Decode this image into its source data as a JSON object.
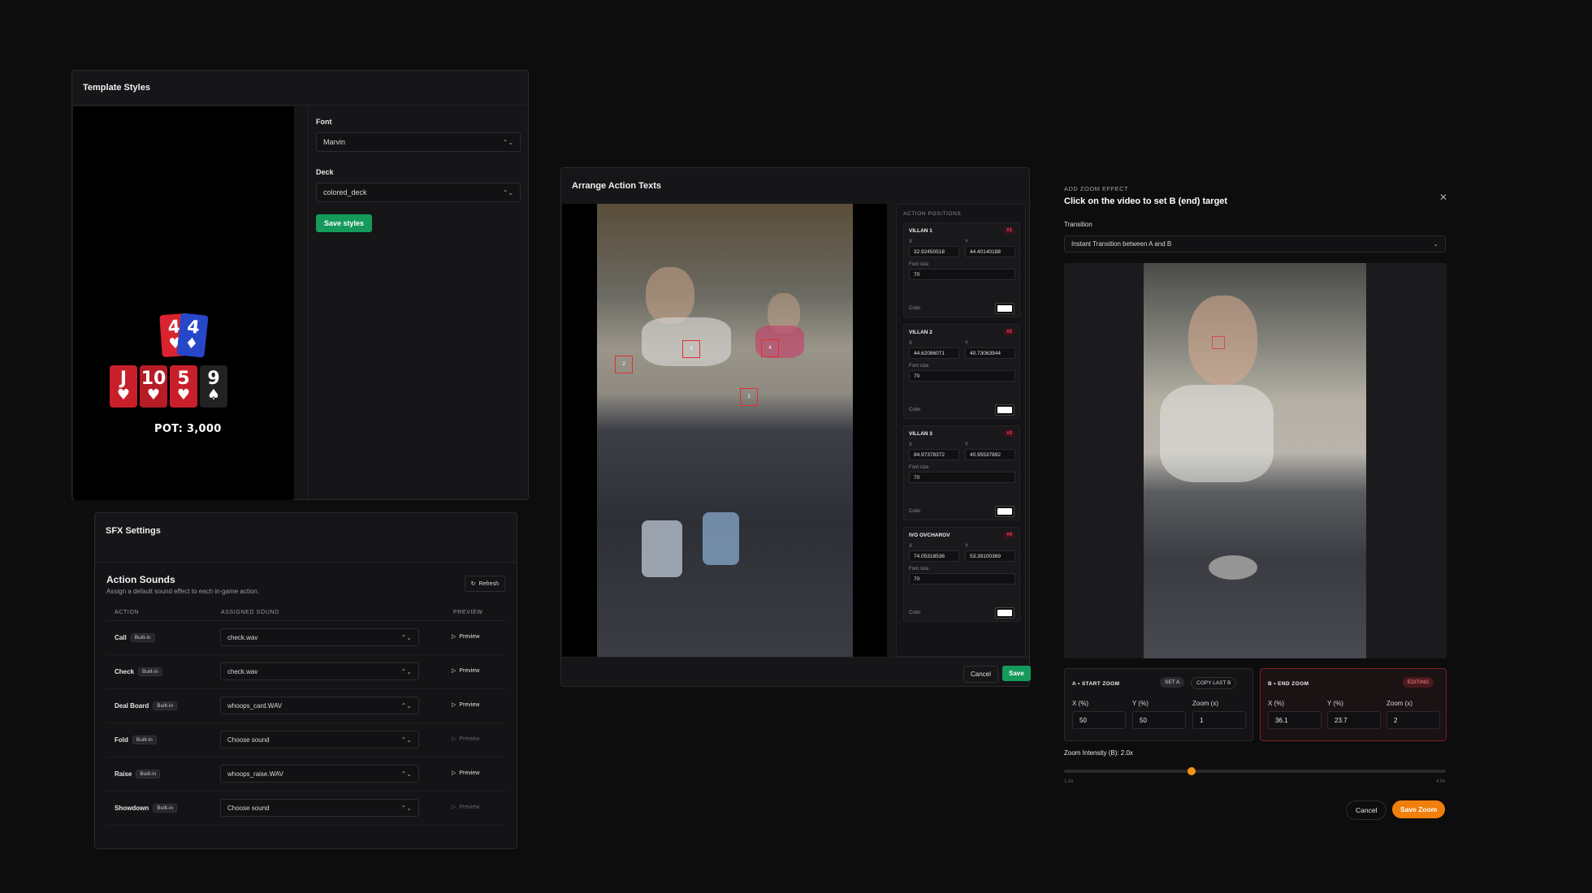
{
  "template_styles": {
    "title": "Template Styles",
    "font_label": "Font",
    "font_value": "Marvin",
    "deck_label": "Deck",
    "deck_value": "colored_deck",
    "save_label": "Save styles",
    "preview": {
      "hole_cards": [
        {
          "rank": "4",
          "suit": "♥",
          "color": "#d9232e"
        },
        {
          "rank": "4",
          "suit": "♦",
          "color": "#2747c9"
        }
      ],
      "board_cards": [
        {
          "rank": "J",
          "suit": "♥",
          "color": "#c81f2a"
        },
        {
          "rank": "10",
          "suit": "♥",
          "color": "#b51c26"
        },
        {
          "rank": "5",
          "suit": "♥",
          "color": "#c81f2a"
        },
        {
          "rank": "9",
          "suit": "♠",
          "color": "#222"
        }
      ],
      "pot_text": "POT: 3,000"
    }
  },
  "sfx": {
    "title": "SFX Settings",
    "heading": "Action Sounds",
    "subtitle": "Assign a default sound effect to each in-game action.",
    "refresh_label": "Refresh",
    "columns": [
      "ACTION",
      "ASSIGNED SOUND",
      "PREVIEW"
    ],
    "badge_label": "Built-in",
    "preview_label": "Preview",
    "rows": [
      {
        "action": "Call",
        "sound": "check.wav",
        "enabled": true
      },
      {
        "action": "Check",
        "sound": "check.wav",
        "enabled": true
      },
      {
        "action": "Deal Board",
        "sound": "whoops_card.WAV",
        "enabled": true
      },
      {
        "action": "Fold",
        "sound": "Choose sound",
        "enabled": false
      },
      {
        "action": "Raise",
        "sound": "whoops_raise.WAV",
        "enabled": true
      },
      {
        "action": "Showdown",
        "sound": "Choose sound",
        "enabled": false
      }
    ]
  },
  "arrange": {
    "title": "Arrange Action Texts",
    "list_heading": "ACTION POSITIONS",
    "x_label": "X",
    "y_label": "Y",
    "font_size_label": "Font size",
    "color_label": "Color",
    "markers": [
      "2",
      "1",
      "3",
      "4"
    ],
    "positions": [
      {
        "name": "VILLAN 1",
        "num": "#1",
        "x": "32.92450518",
        "y": "44.40140188",
        "font_size": "70"
      },
      {
        "name": "VILLAN 2",
        "num": "#2",
        "x": "44.62086071",
        "y": "40.73063944",
        "font_size": "70"
      },
      {
        "name": "VILLAN 3",
        "num": "#3",
        "x": "84.97378372",
        "y": "40.95537892",
        "font_size": "70"
      },
      {
        "name": "IVO OVCHAROV",
        "num": "#4",
        "x": "74.05318536",
        "y": "53.39100369",
        "font_size": "70"
      }
    ],
    "cancel_label": "Cancel",
    "save_label": "Save"
  },
  "zoom": {
    "kicker": "ADD ZOOM EFFECT",
    "title": "Click on the video to set B (end) target",
    "transition_label": "Transition",
    "transition_value": "Instant Transition between A and B",
    "a": {
      "title": "A • START ZOOM",
      "set_label": "SET A",
      "copy_label": "COPY LAST B",
      "x_label": "X (%)",
      "y_label": "Y (%)",
      "z_label": "Zoom (x)",
      "x": "50",
      "y": "50",
      "z": "1"
    },
    "b": {
      "title": "B • END ZOOM",
      "tag": "EDITING",
      "x_label": "X (%)",
      "y_label": "Y (%)",
      "z_label": "Zoom (x)",
      "x": "36.1",
      "y": "23.7",
      "z": "2"
    },
    "intensity_label": "Zoom Intensity (B): 2.0x",
    "intensity_value": 2.0,
    "min_label": "1.0x",
    "max_label": "4.0x",
    "cancel_label": "Cancel",
    "save_label": "Save Zoom"
  },
  "colors": {
    "green": "#159a5b",
    "orange": "#f07f0b",
    "red": "#e03030"
  }
}
